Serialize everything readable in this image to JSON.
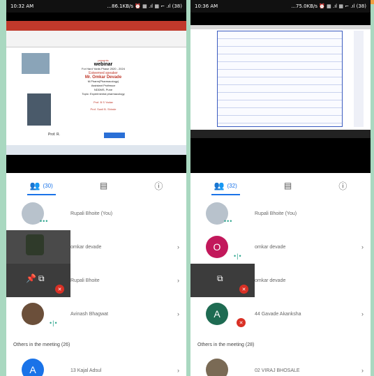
{
  "colors": {
    "accent": "#1a73e8",
    "mute": "#d93025",
    "bg": "#a9d8c0"
  },
  "left": {
    "status_time": "10:32 AM",
    "status_right": "...86.1KB/s ⏰ ▦ .ıl ▦ ⌐ .ıl (38)",
    "slide": {
      "line1": "presents",
      "line2": "webinar",
      "line3": "For Hard Yards Phase 2020 - 2024",
      "line4": "Esteemed speaker",
      "line5": "Mr. Omkar Devade",
      "line6": "M.Pharm(Pharmacology)",
      "line7": "Assistant Professor",
      "line8": "NDDMS, Pune",
      "line9": "Topic: Experimental pharmacology",
      "line10": "Prof. B S Yadav",
      "line11": "Prof. Sunil B. Shinde",
      "footer": "Prof. R."
    },
    "tabs": {
      "people": "(30)"
    },
    "participants": [
      {
        "name": "Rupali Bhoite (You)"
      },
      {
        "name": "omkar devade"
      },
      {
        "name": "Rupali Bhoite"
      },
      {
        "name": "Avinash Bhagwat"
      }
    ],
    "section": "Others in the meeting (26)",
    "others": [
      {
        "initial": "A",
        "name": "13 Kajal Adsul"
      }
    ]
  },
  "right": {
    "status_time": "10:36 AM",
    "status_right": "...75.0KB/s ⏰ ▦ .ıl ▦ ⌐ .ıl (38)",
    "tabs": {
      "people": "(32)"
    },
    "participants": [
      {
        "name": "Rupali Bhoite (You)"
      },
      {
        "initial": "O",
        "name": "omkar devade"
      },
      {
        "name": "omkar devade"
      },
      {
        "initial": "A",
        "name": "44 Gavade Akanksha"
      }
    ],
    "section": "Others in the meeting (28)",
    "others": [
      {
        "name": "02 VIRAJ BHOSALE"
      }
    ]
  }
}
